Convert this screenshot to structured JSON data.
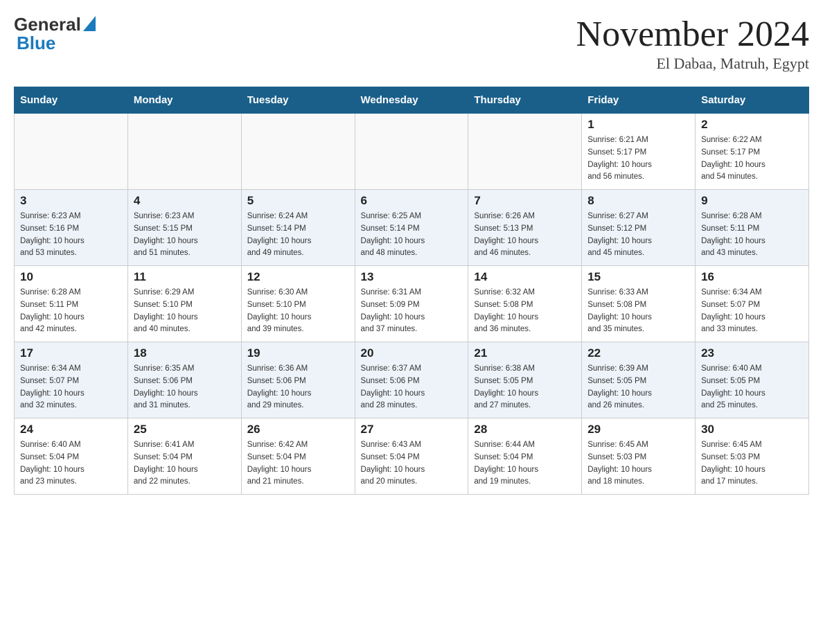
{
  "header": {
    "logo_general": "General",
    "logo_blue": "Blue",
    "month_title": "November 2024",
    "location": "El Dabaa, Matruh, Egypt"
  },
  "days_of_week": [
    "Sunday",
    "Monday",
    "Tuesday",
    "Wednesday",
    "Thursday",
    "Friday",
    "Saturday"
  ],
  "weeks": [
    [
      {
        "day": "",
        "info": ""
      },
      {
        "day": "",
        "info": ""
      },
      {
        "day": "",
        "info": ""
      },
      {
        "day": "",
        "info": ""
      },
      {
        "day": "",
        "info": ""
      },
      {
        "day": "1",
        "info": "Sunrise: 6:21 AM\nSunset: 5:17 PM\nDaylight: 10 hours\nand 56 minutes."
      },
      {
        "day": "2",
        "info": "Sunrise: 6:22 AM\nSunset: 5:17 PM\nDaylight: 10 hours\nand 54 minutes."
      }
    ],
    [
      {
        "day": "3",
        "info": "Sunrise: 6:23 AM\nSunset: 5:16 PM\nDaylight: 10 hours\nand 53 minutes."
      },
      {
        "day": "4",
        "info": "Sunrise: 6:23 AM\nSunset: 5:15 PM\nDaylight: 10 hours\nand 51 minutes."
      },
      {
        "day": "5",
        "info": "Sunrise: 6:24 AM\nSunset: 5:14 PM\nDaylight: 10 hours\nand 49 minutes."
      },
      {
        "day": "6",
        "info": "Sunrise: 6:25 AM\nSunset: 5:14 PM\nDaylight: 10 hours\nand 48 minutes."
      },
      {
        "day": "7",
        "info": "Sunrise: 6:26 AM\nSunset: 5:13 PM\nDaylight: 10 hours\nand 46 minutes."
      },
      {
        "day": "8",
        "info": "Sunrise: 6:27 AM\nSunset: 5:12 PM\nDaylight: 10 hours\nand 45 minutes."
      },
      {
        "day": "9",
        "info": "Sunrise: 6:28 AM\nSunset: 5:11 PM\nDaylight: 10 hours\nand 43 minutes."
      }
    ],
    [
      {
        "day": "10",
        "info": "Sunrise: 6:28 AM\nSunset: 5:11 PM\nDaylight: 10 hours\nand 42 minutes."
      },
      {
        "day": "11",
        "info": "Sunrise: 6:29 AM\nSunset: 5:10 PM\nDaylight: 10 hours\nand 40 minutes."
      },
      {
        "day": "12",
        "info": "Sunrise: 6:30 AM\nSunset: 5:10 PM\nDaylight: 10 hours\nand 39 minutes."
      },
      {
        "day": "13",
        "info": "Sunrise: 6:31 AM\nSunset: 5:09 PM\nDaylight: 10 hours\nand 37 minutes."
      },
      {
        "day": "14",
        "info": "Sunrise: 6:32 AM\nSunset: 5:08 PM\nDaylight: 10 hours\nand 36 minutes."
      },
      {
        "day": "15",
        "info": "Sunrise: 6:33 AM\nSunset: 5:08 PM\nDaylight: 10 hours\nand 35 minutes."
      },
      {
        "day": "16",
        "info": "Sunrise: 6:34 AM\nSunset: 5:07 PM\nDaylight: 10 hours\nand 33 minutes."
      }
    ],
    [
      {
        "day": "17",
        "info": "Sunrise: 6:34 AM\nSunset: 5:07 PM\nDaylight: 10 hours\nand 32 minutes."
      },
      {
        "day": "18",
        "info": "Sunrise: 6:35 AM\nSunset: 5:06 PM\nDaylight: 10 hours\nand 31 minutes."
      },
      {
        "day": "19",
        "info": "Sunrise: 6:36 AM\nSunset: 5:06 PM\nDaylight: 10 hours\nand 29 minutes."
      },
      {
        "day": "20",
        "info": "Sunrise: 6:37 AM\nSunset: 5:06 PM\nDaylight: 10 hours\nand 28 minutes."
      },
      {
        "day": "21",
        "info": "Sunrise: 6:38 AM\nSunset: 5:05 PM\nDaylight: 10 hours\nand 27 minutes."
      },
      {
        "day": "22",
        "info": "Sunrise: 6:39 AM\nSunset: 5:05 PM\nDaylight: 10 hours\nand 26 minutes."
      },
      {
        "day": "23",
        "info": "Sunrise: 6:40 AM\nSunset: 5:05 PM\nDaylight: 10 hours\nand 25 minutes."
      }
    ],
    [
      {
        "day": "24",
        "info": "Sunrise: 6:40 AM\nSunset: 5:04 PM\nDaylight: 10 hours\nand 23 minutes."
      },
      {
        "day": "25",
        "info": "Sunrise: 6:41 AM\nSunset: 5:04 PM\nDaylight: 10 hours\nand 22 minutes."
      },
      {
        "day": "26",
        "info": "Sunrise: 6:42 AM\nSunset: 5:04 PM\nDaylight: 10 hours\nand 21 minutes."
      },
      {
        "day": "27",
        "info": "Sunrise: 6:43 AM\nSunset: 5:04 PM\nDaylight: 10 hours\nand 20 minutes."
      },
      {
        "day": "28",
        "info": "Sunrise: 6:44 AM\nSunset: 5:04 PM\nDaylight: 10 hours\nand 19 minutes."
      },
      {
        "day": "29",
        "info": "Sunrise: 6:45 AM\nSunset: 5:03 PM\nDaylight: 10 hours\nand 18 minutes."
      },
      {
        "day": "30",
        "info": "Sunrise: 6:45 AM\nSunset: 5:03 PM\nDaylight: 10 hours\nand 17 minutes."
      }
    ]
  ]
}
